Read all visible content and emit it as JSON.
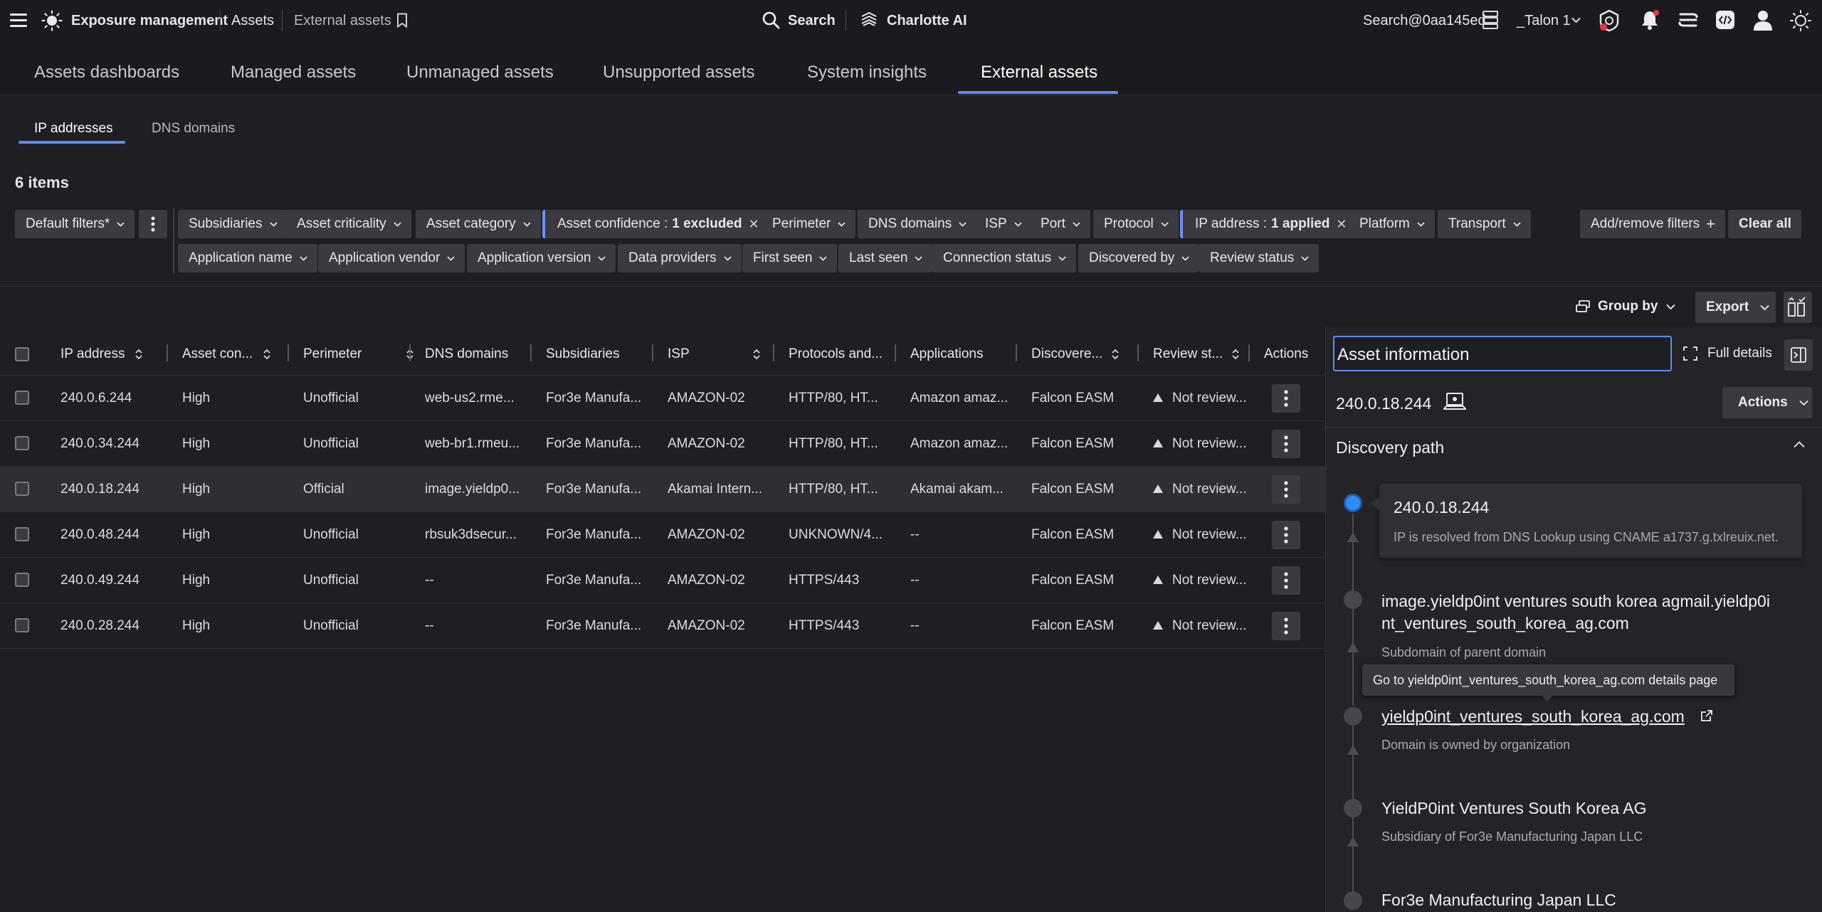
{
  "topbar": {
    "product": "Exposure management",
    "crumb1": "Assets",
    "crumb2": "External assets",
    "search": "Search",
    "charlotte": "Charlotte AI",
    "account": "Search@0aa145ed",
    "tenant": "_Talon 1"
  },
  "tabs": [
    "Assets dashboards",
    "Managed assets",
    "Unmanaged assets",
    "Unsupported assets",
    "System insights",
    "External assets"
  ],
  "subtabs": [
    "IP addresses",
    "DNS domains"
  ],
  "item_count": "6 items",
  "filters": {
    "default": "Default filters*",
    "row1": [
      "Subsidiaries",
      "Asset criticality",
      "Asset category"
    ],
    "asset_confidence": {
      "label": "Asset confidence :",
      "value": "1 excluded"
    },
    "row1b": [
      "Perimeter",
      "DNS domains",
      "ISP",
      "Port",
      "Protocol"
    ],
    "ip_address": {
      "label": "IP address :",
      "value": "1 applied"
    },
    "row1c": [
      "Platform",
      "Transport"
    ],
    "row2": [
      "Application name",
      "Application vendor",
      "Application version",
      "Data providers",
      "First seen",
      "Last seen",
      "Connection status",
      "Discovered by",
      "Review status"
    ],
    "add_remove": "Add/remove filters",
    "clear_all": "Clear all"
  },
  "toolbar": {
    "group_by": "Group by",
    "export": "Export"
  },
  "columns": [
    "IP address",
    "Asset con...",
    "Perimeter",
    "DNS domains",
    "Subsidiaries",
    "ISP",
    "Protocols and...",
    "Applications",
    "Discovere...",
    "Review st...",
    "Actions"
  ],
  "rows": [
    [
      "240.0.6.244",
      "High",
      "Unofficial",
      "web-us2.rme...",
      "For3e Manufa...",
      "AMAZON-02",
      "HTTP/80, HT...",
      "Amazon amaz...",
      "Falcon EASM",
      "Not review..."
    ],
    [
      "240.0.34.244",
      "High",
      "Unofficial",
      "web-br1.rmeu...",
      "For3e Manufa...",
      "AMAZON-02",
      "HTTP/80, HT...",
      "Amazon amaz...",
      "Falcon EASM",
      "Not review..."
    ],
    [
      "240.0.18.244",
      "High",
      "Official",
      "image.yieldp0...",
      "For3e Manufa...",
      "Akamai Intern...",
      "HTTP/80, HT...",
      "Akamai akam...",
      "Falcon EASM",
      "Not review..."
    ],
    [
      "240.0.48.244",
      "High",
      "Unofficial",
      "rbsuk3dsecur...",
      "For3e Manufa...",
      "AMAZON-02",
      "UNKNOWN/4...",
      "--",
      "Falcon EASM",
      "Not review..."
    ],
    [
      "240.0.49.244",
      "High",
      "Unofficial",
      "--",
      "For3e Manufa...",
      "AMAZON-02",
      "HTTPS/443",
      "--",
      "Falcon EASM",
      "Not review..."
    ],
    [
      "240.0.28.244",
      "High",
      "Unofficial",
      "--",
      "For3e Manufa...",
      "AMAZON-02",
      "HTTPS/443",
      "--",
      "Falcon EASM",
      "Not review..."
    ]
  ],
  "panel": {
    "title": "Asset information",
    "full_details": "Full details",
    "ip": "240.0.18.244",
    "actions": "Actions",
    "discovery_path": "Discovery path",
    "tooltip": "Go to yieldp0int_ventures_south_korea_ag.com details page",
    "nodes": [
      {
        "title": "240.0.18.244",
        "sub": "IP is resolved from DNS Lookup using CNAME a1737.g.txlreuix.net."
      },
      {
        "title1": "image.yieldp0int ventures south korea agmail.yieldp0i",
        "title2": "nt_ventures_south_korea_ag.com",
        "sub": "Subdomain of parent domain"
      },
      {
        "title": "yieldp0int_ventures_south_korea_ag.com",
        "sub": "Domain is owned by organization"
      },
      {
        "title": "YieldP0int Ventures South Korea AG",
        "sub": "Subsidiary of For3e Manufacturing Japan LLC"
      },
      {
        "title": "For3e Manufacturing Japan LLC"
      }
    ]
  },
  "colors": {
    "accent": "#5b8cf7",
    "active_dot": "#2f8cf4",
    "bg": "#1f1f23"
  }
}
